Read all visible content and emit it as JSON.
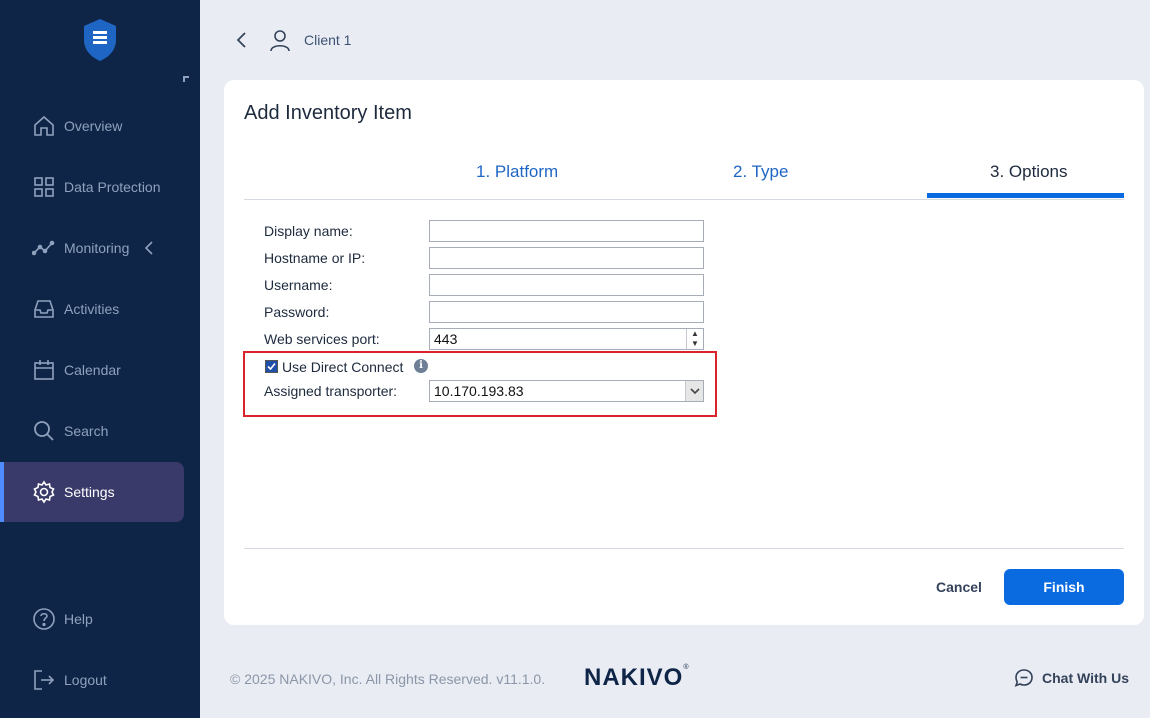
{
  "app": {
    "brand": "NAKIVO",
    "brand_mark": "®",
    "copyright": "© 2025 NAKIVO, Inc. All Rights Reserved. v11.1.0."
  },
  "header": {
    "breadcrumb": "Client 1"
  },
  "sidebar": {
    "items": [
      {
        "label": "Overview",
        "icon": "home-icon"
      },
      {
        "label": "Data Protection",
        "icon": "grid-icon"
      },
      {
        "label": "Monitoring",
        "icon": "chart-line-icon"
      },
      {
        "label": "Activities",
        "icon": "inbox-icon"
      },
      {
        "label": "Calendar",
        "icon": "calendar-icon"
      },
      {
        "label": "Search",
        "icon": "search-icon"
      },
      {
        "label": "Settings",
        "icon": "gear-icon"
      }
    ],
    "bottom": [
      {
        "label": "Help",
        "icon": "help-icon"
      },
      {
        "label": "Logout",
        "icon": "logout-icon"
      }
    ]
  },
  "dialog": {
    "title": "Add Inventory Item",
    "tabs": [
      "1. Platform",
      "2. Type",
      "3. Options"
    ],
    "active_tab": "3. Options",
    "fields": {
      "display_name": {
        "label": "Display name:",
        "value": ""
      },
      "hostname": {
        "label": "Hostname or IP:",
        "value": ""
      },
      "username": {
        "label": "Username:",
        "value": ""
      },
      "password": {
        "label": "Password:",
        "value": ""
      },
      "port": {
        "label": "Web services port:",
        "value": "443"
      }
    },
    "direct_connect": {
      "label": "Use Direct Connect",
      "checked": true
    },
    "transporter": {
      "label": "Assigned transporter:",
      "value": "10.170.193.83"
    },
    "cancel_label": "Cancel",
    "finish_label": "Finish"
  },
  "chat": {
    "label": "Chat With Us"
  },
  "colors": {
    "sidebar_bg": "#0f2547",
    "accent": "#0a6be0",
    "highlight_border": "#d9232a"
  }
}
